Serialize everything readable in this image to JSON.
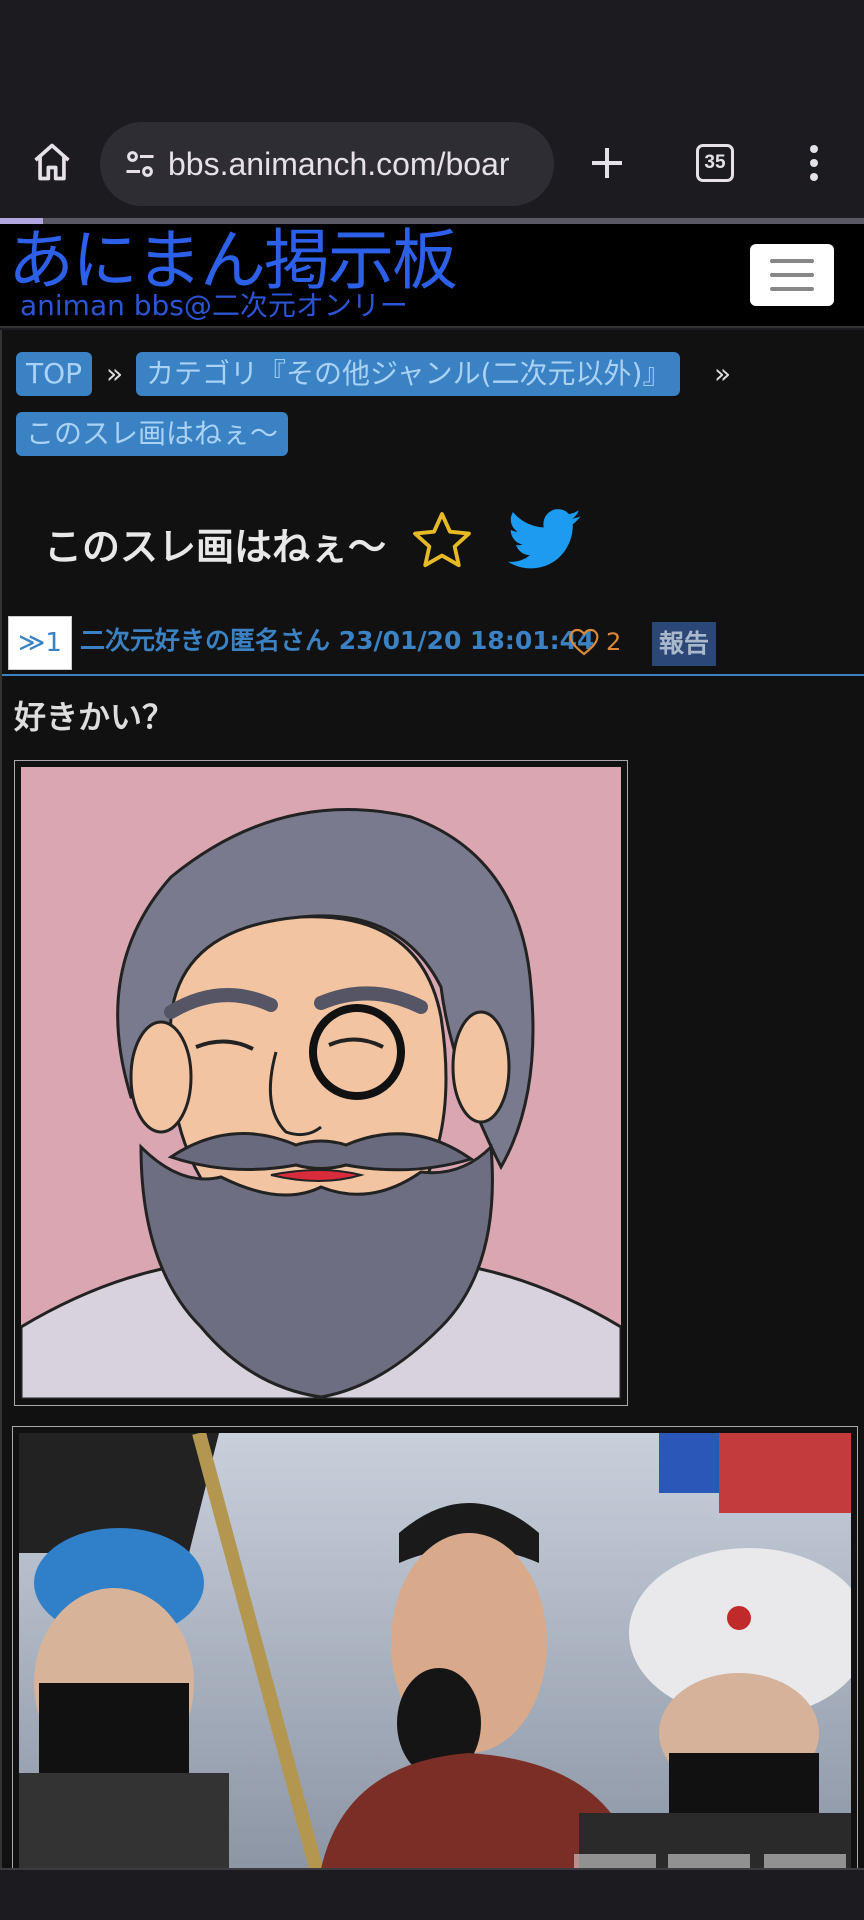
{
  "browser": {
    "url": "bbs.animanch.com/boar",
    "tab_count": "35",
    "page_load_progress": 0.05,
    "icons": [
      "home-icon",
      "tune-icon",
      "plus-icon",
      "tabs-icon",
      "more-vert-icon"
    ]
  },
  "site": {
    "logo_main": "あにまん掲示板",
    "logo_sub": "animan bbs@二次元オンリー",
    "brand_color": "#2c60e8"
  },
  "breadcrumb": {
    "items": [
      {
        "label": "TOP"
      },
      {
        "label": "カテゴリ『その他ジャンル(二次元以外)』"
      },
      {
        "label": "このスレ画はねぇ〜"
      }
    ],
    "separator": "»"
  },
  "thread": {
    "title": "このスレ画はねぇ〜",
    "icons": [
      "star-icon",
      "twitter-icon"
    ]
  },
  "post": {
    "number": "≫1",
    "author_time": "二次元好きの匿名さん 23/01/20 18:01:44",
    "likes": "2",
    "report_label": "報告",
    "body": "好きかい？",
    "accent_color": "#3a82c4"
  },
  "floating": {
    "icons": [
      "scroll-top-icon",
      "edit-icon",
      "gear-icon"
    ]
  }
}
